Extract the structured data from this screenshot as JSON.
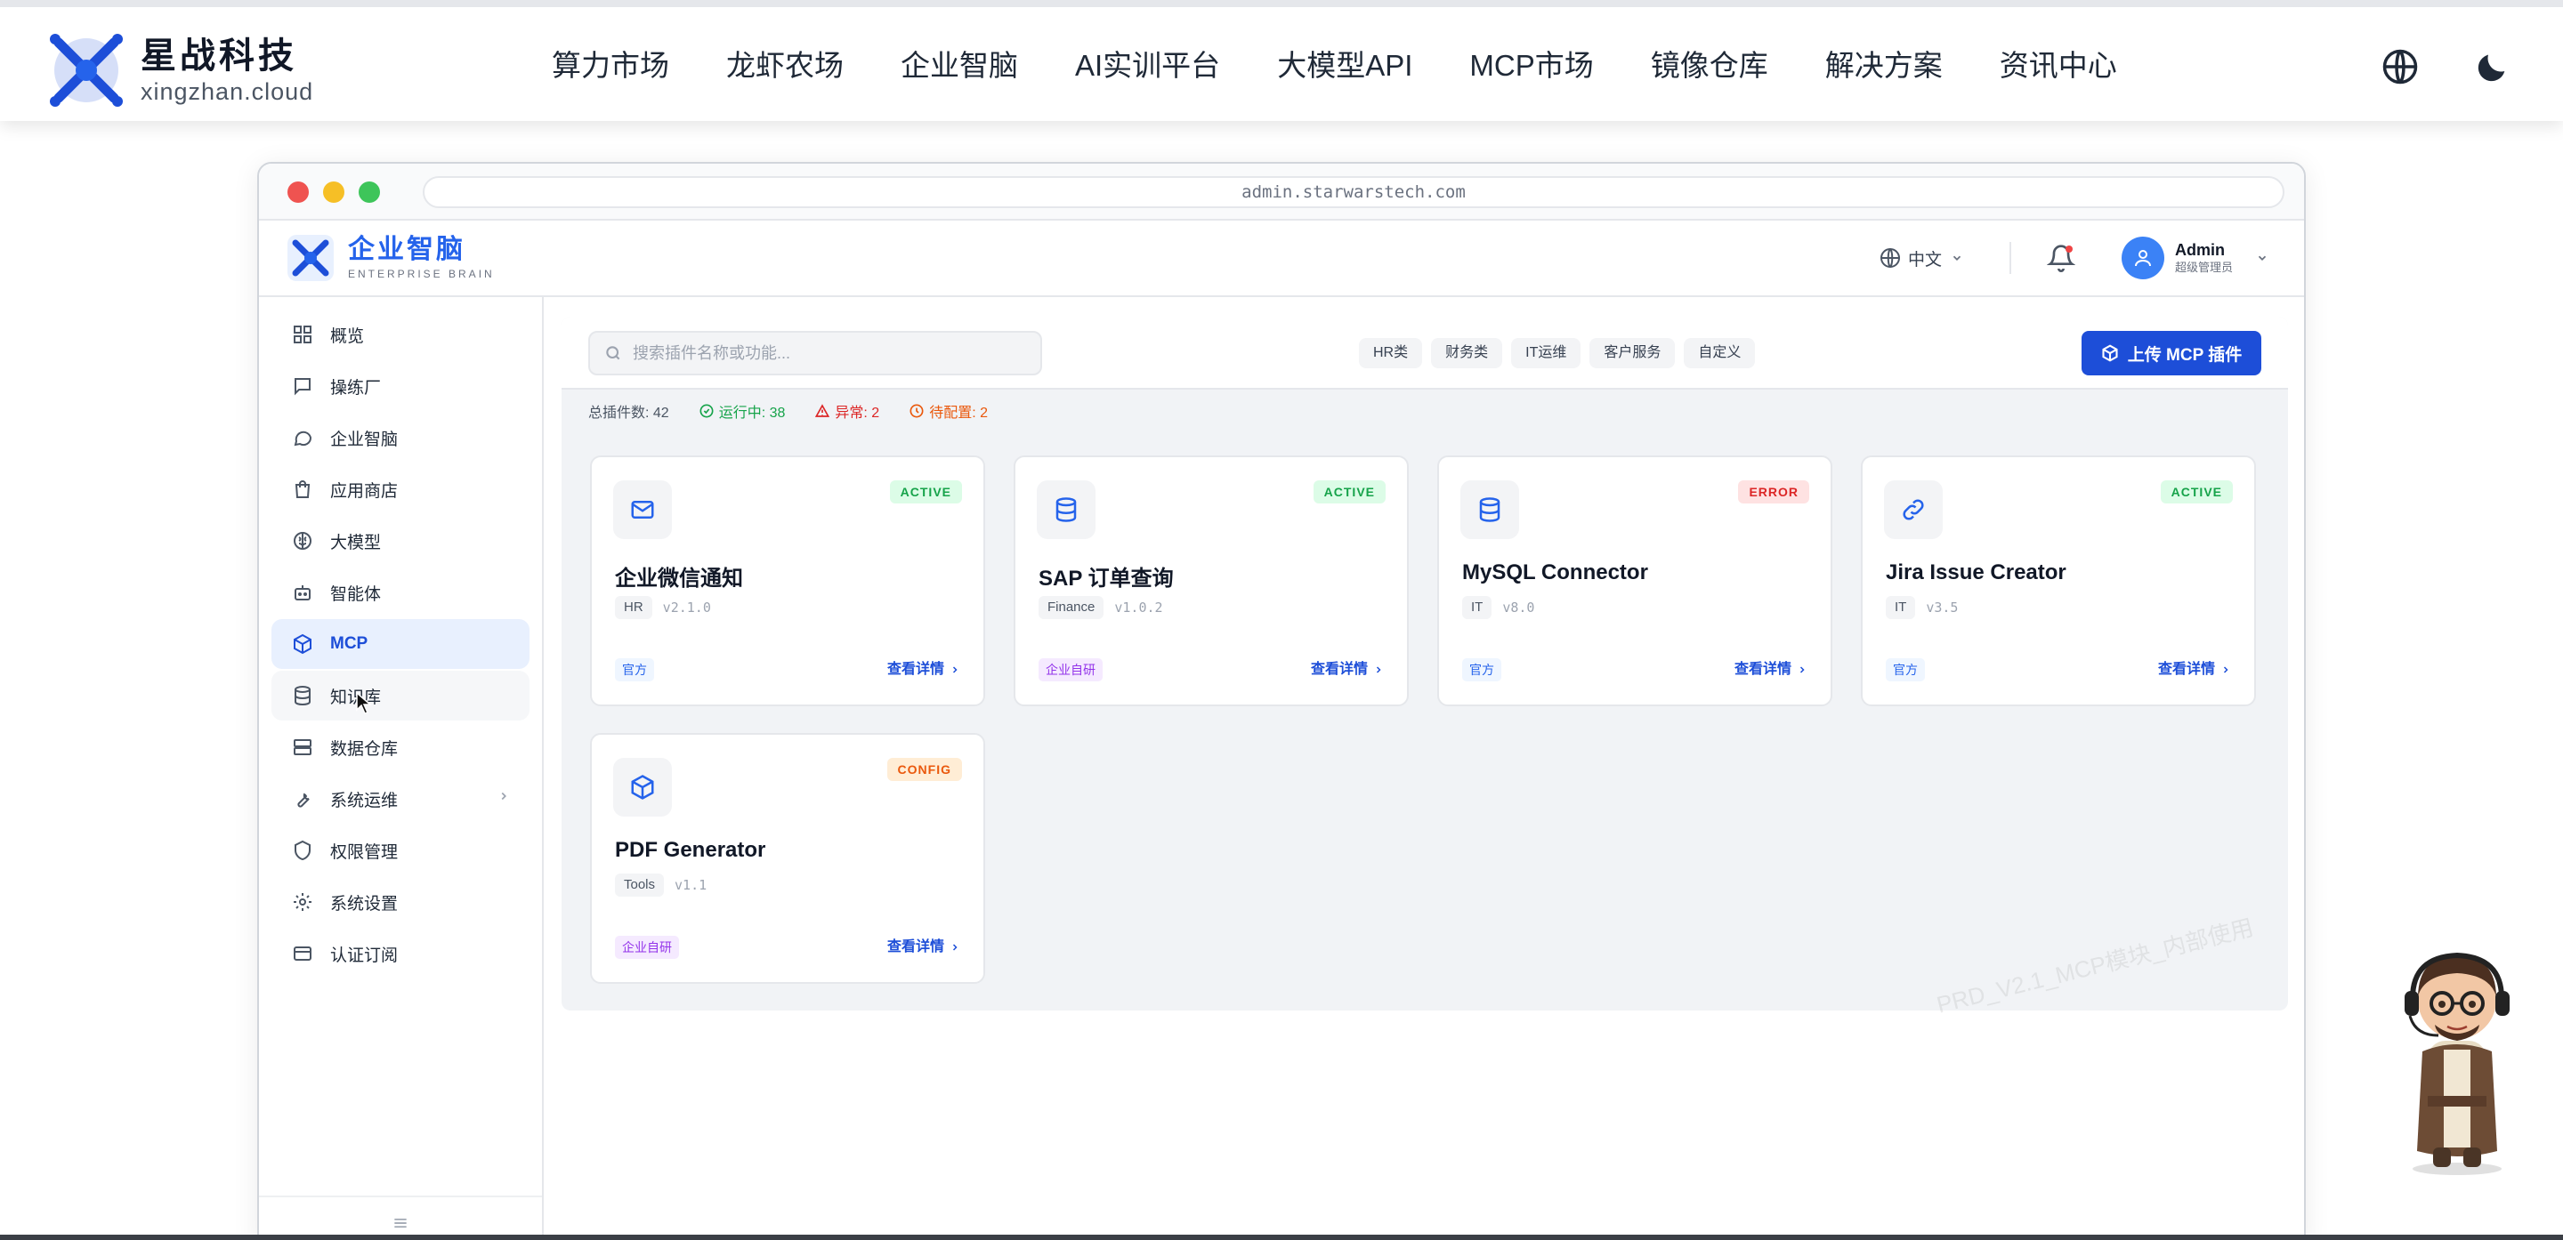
{
  "site": {
    "brand_cn": "星战科技",
    "brand_en": "xingzhan.cloud",
    "nav": [
      "算力市场",
      "龙虾农场",
      "企业智脑",
      "AI实训平台",
      "大模型API",
      "MCP市场",
      "镜像仓库",
      "解决方案",
      "资讯中心"
    ],
    "icons": {
      "language": "globe-icon",
      "theme": "moon-icon"
    }
  },
  "browser": {
    "url": "admin.starwarstech.com"
  },
  "app": {
    "title_cn": "企业智脑",
    "title_en": "ENTERPRISE BRAIN",
    "lang": "中文",
    "user": {
      "name": "Admin",
      "role": "超级管理员"
    }
  },
  "sidebar": {
    "items": [
      {
        "label": "概览",
        "icon": "grid-icon"
      },
      {
        "label": "操练厂",
        "icon": "chat-square-icon"
      },
      {
        "label": "企业智脑",
        "icon": "chat-bubble-icon"
      },
      {
        "label": "应用商店",
        "icon": "shopping-bag-icon"
      },
      {
        "label": "大模型",
        "icon": "brain-icon"
      },
      {
        "label": "智能体",
        "icon": "robot-icon"
      },
      {
        "label": "MCP",
        "icon": "cube-icon",
        "active": true
      },
      {
        "label": "知识库",
        "icon": "database-icon"
      },
      {
        "label": "数据仓库",
        "icon": "server-icon"
      },
      {
        "label": "系统运维",
        "icon": "wrench-icon",
        "has_children": true
      },
      {
        "label": "权限管理",
        "icon": "shield-icon"
      },
      {
        "label": "系统设置",
        "icon": "gear-icon"
      },
      {
        "label": "认证订阅",
        "icon": "card-icon"
      }
    ]
  },
  "toolbar": {
    "search_placeholder": "搜索插件名称或功能...",
    "filters": [
      "HR类",
      "财务类",
      "IT运维",
      "客户服务",
      "自定义"
    ],
    "upload_label": "上传 MCP 插件"
  },
  "stats": {
    "total": "总插件数: 42",
    "running": "运行中: 38",
    "error": "异常: 2",
    "config": "待配置: 2"
  },
  "plugins": [
    {
      "name": "企业微信通知",
      "icon": "mail-icon",
      "status": "ACTIVE",
      "category": "HR",
      "version": "v2.1.0",
      "source": "官方",
      "link": "查看详情"
    },
    {
      "name": "SAP 订单查询",
      "icon": "database-icon",
      "status": "ACTIVE",
      "category": "Finance",
      "version": "v1.0.2",
      "source": "企业自研",
      "link": "查看详情"
    },
    {
      "name": "MySQL Connector",
      "icon": "database-icon",
      "status": "ERROR",
      "category": "IT",
      "version": "v8.0",
      "source": "官方",
      "link": "查看详情"
    },
    {
      "name": "Jira Issue Creator",
      "icon": "link-icon",
      "status": "ACTIVE",
      "category": "IT",
      "version": "v3.5",
      "source": "官方",
      "link": "查看详情"
    },
    {
      "name": "PDF Generator",
      "icon": "cube-icon",
      "status": "CONFIG",
      "category": "Tools",
      "version": "v1.1",
      "source": "企业自研",
      "link": "查看详情"
    }
  ],
  "watermark": "PRD_V2.1_MCP模块_内部使用",
  "colors": {
    "accent": "#1d4ed8",
    "active": "#16a34a",
    "error": "#dc2626",
    "config": "#ea580c"
  }
}
